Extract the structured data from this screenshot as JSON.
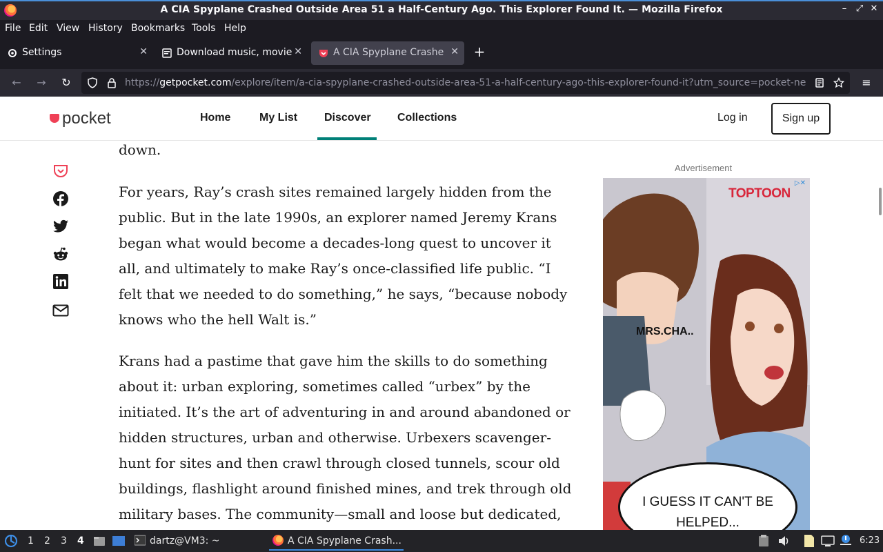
{
  "window": {
    "title": "A CIA Spyplane Crashed Outside Area 51 a Half-Century Ago. This Explorer Found It. — Mozilla Firefox"
  },
  "menu": [
    "File",
    "Edit",
    "View",
    "History",
    "Bookmarks",
    "Tools",
    "Help"
  ],
  "tabs": [
    {
      "label": "Settings",
      "icon": "gear-icon",
      "active": false
    },
    {
      "label": "Download music, movies",
      "icon": "page-icon",
      "active": false
    },
    {
      "label": "A CIA Spyplane Crashed",
      "icon": "pocket-icon",
      "active": true
    }
  ],
  "url": {
    "prefix": "https://",
    "host": "getpocket.com",
    "path": "/explore/item/a-cia-spyplane-crashed-outside-area-51-a-half-century-ago-this-explorer-found-it?utm_source=pocket-ne"
  },
  "site": {
    "logo_text": "pocket",
    "nav": [
      "Home",
      "My List",
      "Discover",
      "Collections"
    ],
    "active_nav": "Discover",
    "login": "Log in",
    "signup": "Sign up"
  },
  "share": [
    "pocket-save-icon",
    "facebook-icon",
    "twitter-icon",
    "reddit-icon",
    "linkedin-icon",
    "email-icon"
  ],
  "article": {
    "p0": "down.",
    "p1": "For years, Ray’s crash sites remained largely hidden from the public. But in the late 1990s, an explorer named Jeremy Krans began what would become a decades-long quest to uncover it all, and ultimately to make Ray’s once-classified life public. “I felt that we needed to do something,” he says, “because nobody knows who the hell Walt is.”",
    "p2": "Krans had a pastime that gave him the skills to do something about it: urban exploring, sometimes called “urbex” by the initiated. It’s the art of adventuring in and around abandoned or hidden structures, urban and otherwise. Urbexers scavenger-hunt for sites and then crawl through closed tunnels, scour old buildings, flashlight around finished mines, and trek through old military bases. The community—small and loose but dedicated, lurking and"
  },
  "ad": {
    "label": "Advertisement",
    "brand": "TOPTOON",
    "bubble1": "MRS.CHA..",
    "bubble2": "I GUESS IT CAN'T BE HELPED..."
  },
  "taskbar": {
    "workspaces": [
      "1",
      "2",
      "3",
      "4"
    ],
    "current_workspace": "4",
    "items": [
      {
        "label": "dartz@VM3: ~",
        "active": false
      },
      {
        "label": "A CIA Spyplane Crash...",
        "active": true
      }
    ],
    "clock": "6:23"
  }
}
